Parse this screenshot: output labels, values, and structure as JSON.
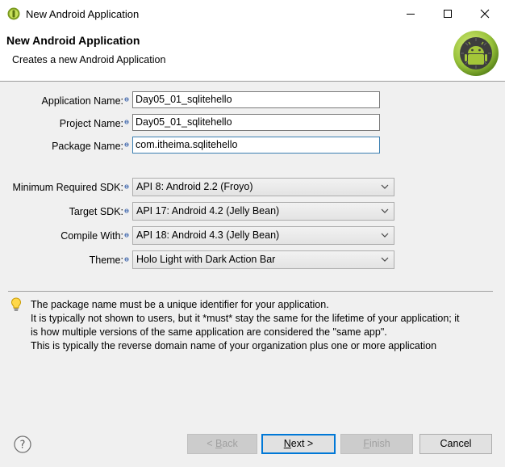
{
  "window": {
    "title": "New Android Application"
  },
  "header": {
    "title": "New Android Application",
    "description": "Creates a new Android Application"
  },
  "form": {
    "application_name_label": "Application Name:",
    "application_name_value": "Day05_01_sqlitehello",
    "project_name_label": "Project Name:",
    "project_name_value": "Day05_01_sqlitehello",
    "package_name_label": "Package Name:",
    "package_name_value": "com.itheima.sqlitehello",
    "min_sdk_label": "Minimum Required SDK:",
    "min_sdk_value": "API 8: Android 2.2 (Froyo)",
    "target_sdk_label": "Target SDK:",
    "target_sdk_value": "API 17: Android 4.2 (Jelly Bean)",
    "compile_with_label": "Compile With:",
    "compile_with_value": "API 18: Android 4.3 (Jelly Bean)",
    "theme_label": "Theme:",
    "theme_value": "Holo Light with Dark Action Bar"
  },
  "info": {
    "line1": "The package name must be a unique identifier for your application.",
    "line2": "It is typically not shown to users, but it *must* stay the same for the lifetime of your application; it",
    "line3": "is how multiple versions of the same application are considered the \"same app\".",
    "line4": "This is typically the reverse domain name of your organization plus one or more application"
  },
  "buttons": {
    "back_prefix": "< ",
    "back_mnemonic": "B",
    "back_rest": "ack",
    "next_mnemonic": "N",
    "next_rest": "ext >",
    "finish_mnemonic": "F",
    "finish_rest": "inish",
    "cancel": "Cancel"
  },
  "colors": {
    "accent": "#0078d7",
    "android_green": "#a4c639",
    "dialog_bg": "#f0f0f0"
  }
}
